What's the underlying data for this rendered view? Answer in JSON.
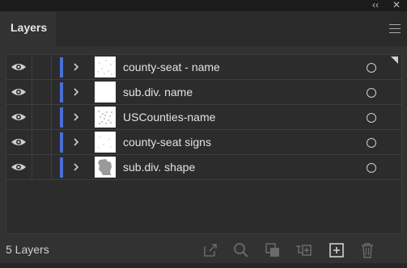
{
  "window": {
    "collapse_glyph": "‹‹",
    "close_glyph": "✕"
  },
  "tabs": [
    {
      "label": "Layers"
    }
  ],
  "layers": [
    {
      "name": "county-seat - name",
      "thumb": "dots-sparse"
    },
    {
      "name": "sub.div. name",
      "thumb": "blank"
    },
    {
      "name": "USCounties-name",
      "thumb": "dots-dense"
    },
    {
      "name": "county-seat signs",
      "thumb": "dots-sparse"
    },
    {
      "name": "sub.div. shape",
      "thumb": "map-shape"
    }
  ],
  "footer": {
    "layer_count_label": "5 Layers",
    "icons": [
      "export-icon",
      "search-icon",
      "clipping-mask-icon",
      "new-sublayer-icon",
      "new-layer-icon",
      "trash-icon"
    ]
  },
  "colors": {
    "layer_color": "#4a6fd6",
    "panel_bg": "#323232",
    "list_bg": "#2c2c2c"
  }
}
